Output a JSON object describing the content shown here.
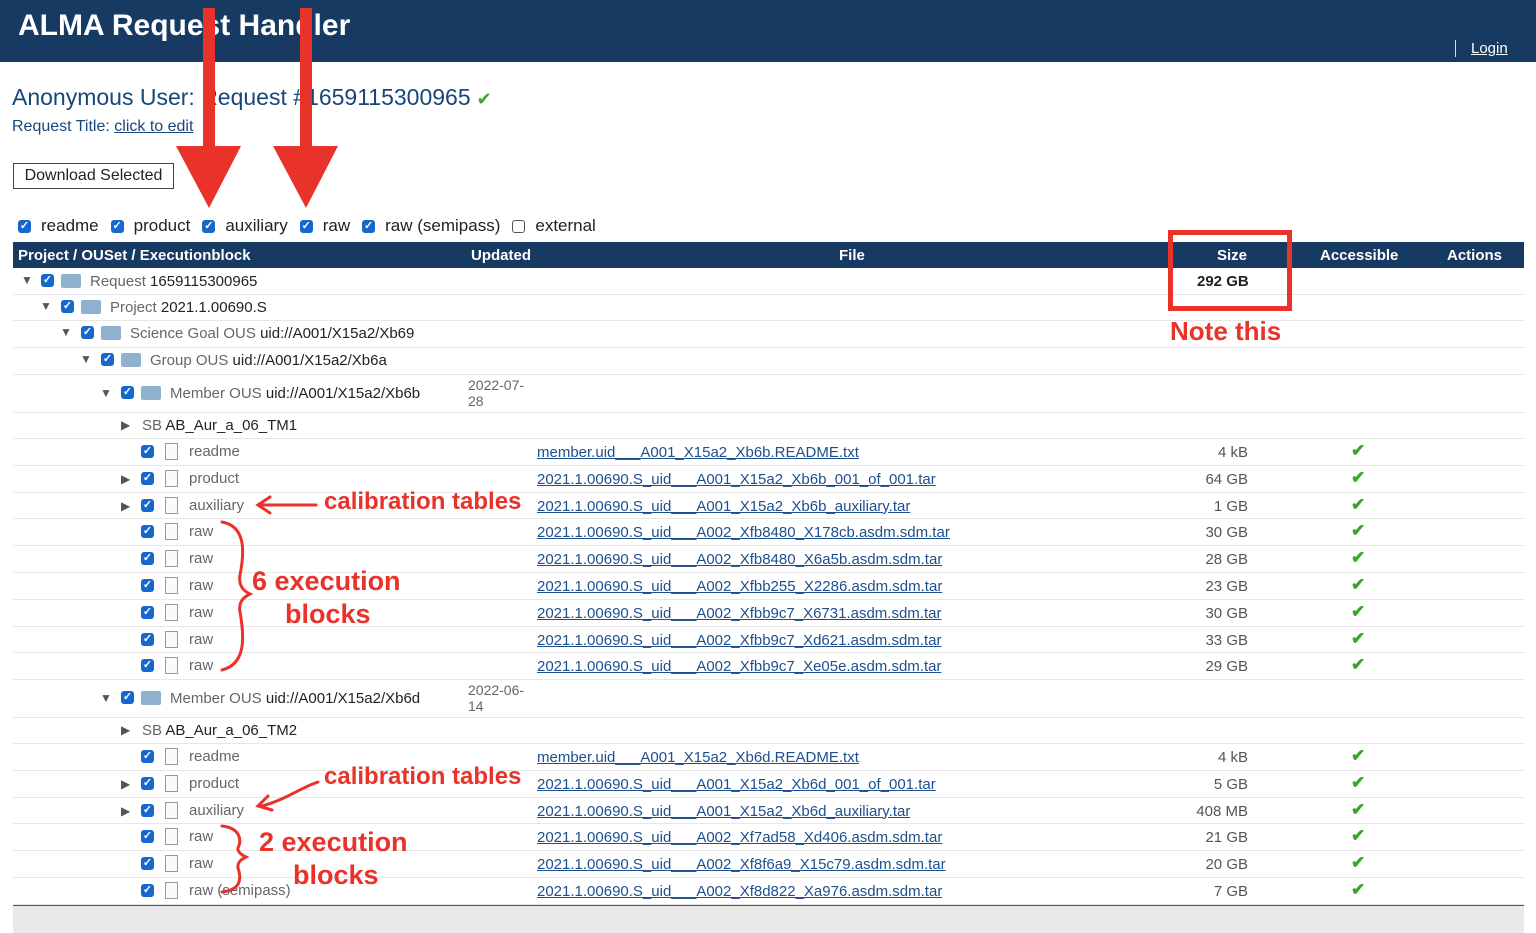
{
  "app": {
    "title": "ALMA Request Handler",
    "login": "Login"
  },
  "heading": {
    "text": "Anonymous User: Request #1659115300965"
  },
  "request_title": {
    "label": "Request Title:",
    "link": "click to edit"
  },
  "download_button": "Download Selected",
  "filters": [
    {
      "label": "readme",
      "checked": true
    },
    {
      "label": "product",
      "checked": true
    },
    {
      "label": "auxiliary",
      "checked": true
    },
    {
      "label": "raw",
      "checked": true
    },
    {
      "label": "raw (semipass)",
      "checked": true
    },
    {
      "label": "external",
      "checked": false
    }
  ],
  "columns": {
    "project": "Project / OUSet / Executionblock",
    "updated": "Updated",
    "file": "File",
    "size": "Size",
    "accessible": "Accessible",
    "actions": "Actions"
  },
  "tree": {
    "request": {
      "label": "Request",
      "value": "1659115300965",
      "size": "292 GB"
    },
    "project": {
      "label": "Project",
      "value": "2021.1.00690.S"
    },
    "science_goal": {
      "label": "Science Goal OUS",
      "value": "uid://A001/X15a2/Xb69"
    },
    "group": {
      "label": "Group OUS",
      "value": "uid://A001/X15a2/Xb6a"
    },
    "member1": {
      "label": "Member OUS",
      "value": "uid://A001/X15a2/Xb6b",
      "updated1": "2022-07-",
      "updated2": "28",
      "sb": "AB_Aur_a_06_TM1"
    },
    "member2": {
      "label": "Member OUS",
      "value": "uid://A001/X15a2/Xb6d",
      "updated1": "2022-06-",
      "updated2": "14",
      "sb": "AB_Aur_a_06_TM2"
    },
    "sb_label": "SB"
  },
  "files1": [
    {
      "type": "readme",
      "file": "member.uid___A001_X15a2_Xb6b.README.txt",
      "size": "4 kB"
    },
    {
      "type": "product",
      "file": "2021.1.00690.S_uid___A001_X15a2_Xb6b_001_of_001.tar",
      "size": "64 GB"
    },
    {
      "type": "auxiliary",
      "file": "2021.1.00690.S_uid___A001_X15a2_Xb6b_auxiliary.tar",
      "size": "1 GB"
    },
    {
      "type": "raw",
      "file": "2021.1.00690.S_uid___A002_Xfb8480_X178cb.asdm.sdm.tar",
      "size": "30 GB"
    },
    {
      "type": "raw",
      "file": "2021.1.00690.S_uid___A002_Xfb8480_X6a5b.asdm.sdm.tar",
      "size": "28 GB"
    },
    {
      "type": "raw",
      "file": "2021.1.00690.S_uid___A002_Xfbb255_X2286.asdm.sdm.tar",
      "size": "23 GB"
    },
    {
      "type": "raw",
      "file": "2021.1.00690.S_uid___A002_Xfbb9c7_X6731.asdm.sdm.tar",
      "size": "30 GB"
    },
    {
      "type": "raw",
      "file": "2021.1.00690.S_uid___A002_Xfbb9c7_Xd621.asdm.sdm.tar",
      "size": "33 GB"
    },
    {
      "type": "raw",
      "file": "2021.1.00690.S_uid___A002_Xfbb9c7_Xe05e.asdm.sdm.tar",
      "size": "29 GB"
    }
  ],
  "files2": [
    {
      "type": "readme",
      "file": "member.uid___A001_X15a2_Xb6d.README.txt",
      "size": "4 kB"
    },
    {
      "type": "product",
      "file": "2021.1.00690.S_uid___A001_X15a2_Xb6d_001_of_001.tar",
      "size": "5 GB"
    },
    {
      "type": "auxiliary",
      "file": "2021.1.00690.S_uid___A001_X15a2_Xb6d_auxiliary.tar",
      "size": "408 MB"
    },
    {
      "type": "raw",
      "file": "2021.1.00690.S_uid___A002_Xf7ad58_Xd406.asdm.sdm.tar",
      "size": "21 GB"
    },
    {
      "type": "raw",
      "file": "2021.1.00690.S_uid___A002_Xf8f6a9_X15c79.asdm.sdm.tar",
      "size": "20 GB"
    },
    {
      "type": "raw (semipass)",
      "file": "2021.1.00690.S_uid___A002_Xf8d822_Xa976.asdm.sdm.tar",
      "size": "7 GB"
    }
  ],
  "annotations": {
    "note": "Note this",
    "calib1": "calibration tables",
    "calib2": "calibration tables",
    "exec6_line1": "6 execution",
    "exec6_line2": "blocks",
    "exec2_line1": "2 execution",
    "exec2_line2": "blocks"
  }
}
